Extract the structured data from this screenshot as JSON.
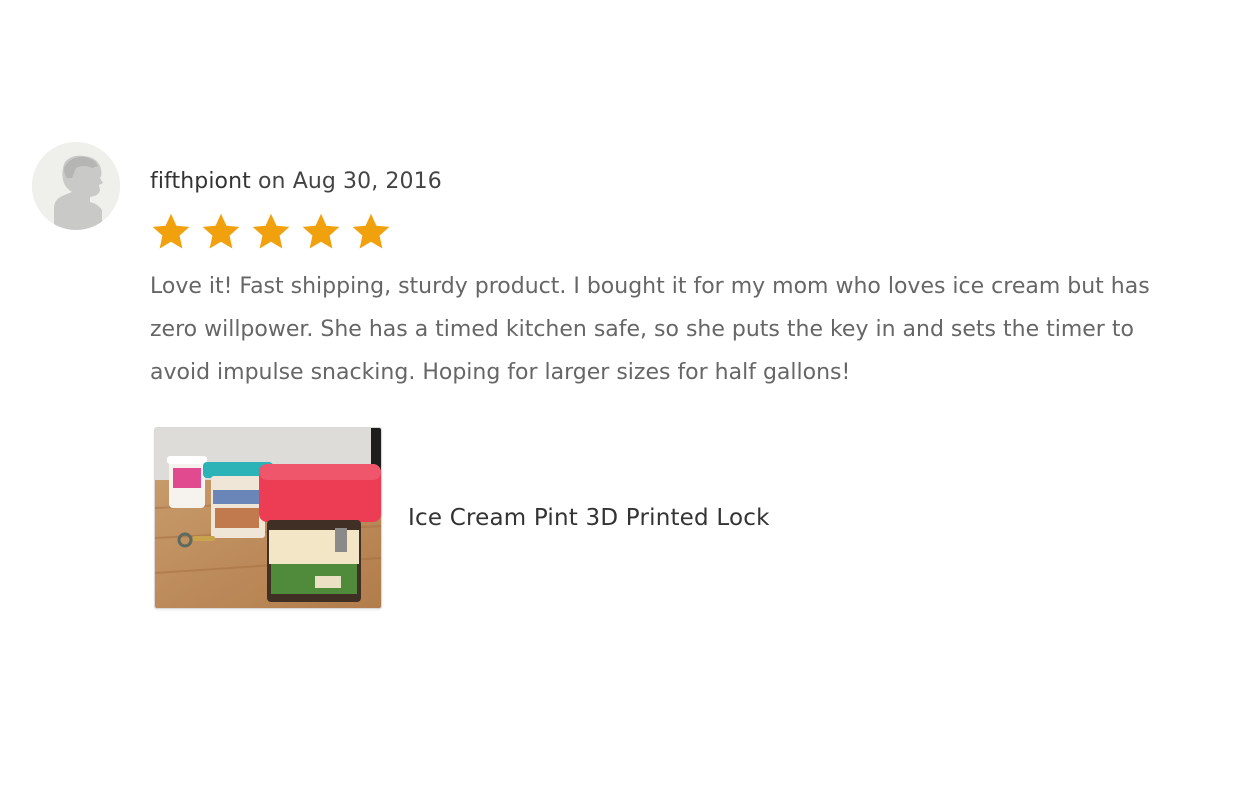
{
  "review": {
    "username": "fifthpiont",
    "date_text": "on Aug 30, 2016",
    "rating": 5,
    "rating_max": 5,
    "text": "Love it! Fast shipping, sturdy product. I bought it for my mom who loves ice cream but has zero willpower. She has a timed kitchen safe, so she puts the key in and sets the timer to avoid impulse snacking. Hoping for larger sizes for half gallons!",
    "avatar_icon": "default-user-silhouette-icon"
  },
  "listing": {
    "title": "Ice Cream Pint 3D Printed Lock",
    "image_icon": "product-photo-ice-cream-pint-lock"
  },
  "colors": {
    "star": "#f1a10d",
    "text_primary": "#333333",
    "text_secondary": "#666666"
  }
}
